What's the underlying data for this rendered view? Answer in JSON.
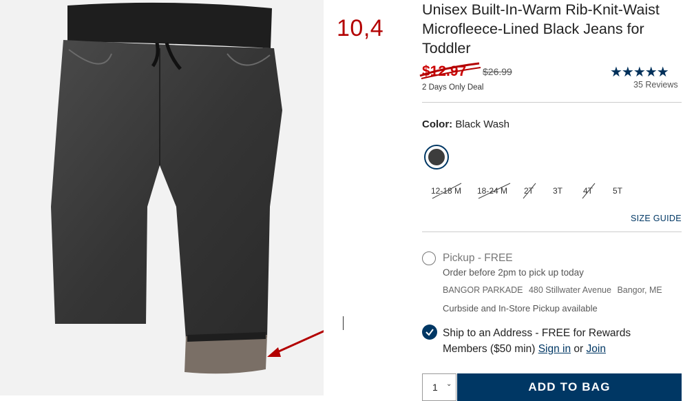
{
  "annotation": {
    "text": "10,4"
  },
  "product": {
    "title": "Unisex Built-In-Warm Rib-Knit-Waist Microfleece-Lined Black Jeans for Toddler",
    "sale_price": "$12.97",
    "original_price": "$26.99",
    "deal_text": "2 Days Only Deal",
    "stars": "★★★★★",
    "rating": 5,
    "reviews": "35 Reviews"
  },
  "color": {
    "label": "Color:",
    "value": "Black Wash",
    "swatch_color": "#3d3d3d"
  },
  "sizes": [
    {
      "label": "12-18 M",
      "available": false
    },
    {
      "label": "18-24 M",
      "available": false
    },
    {
      "label": "2T",
      "available": false
    },
    {
      "label": "3T",
      "available": true
    },
    {
      "label": "4T",
      "available": false
    },
    {
      "label": "5T",
      "available": true
    }
  ],
  "size_guide": "SIZE GUIDE",
  "pickup": {
    "title": "Pickup - FREE",
    "order_note": "Order before 2pm to pick up today",
    "store_name": "BANGOR PARKADE",
    "store_address": "480 Stillwater Avenue",
    "store_city": "Bangor, ME",
    "curbside": "Curbside and In-Store Pickup available"
  },
  "ship": {
    "text_before": "Ship to an Address - FREE for Rewards Members ($50 min)",
    "sign_in": "Sign in",
    "or": "or",
    "join": "Join"
  },
  "quantity": {
    "value": "1",
    "chevron": "⌄"
  },
  "add_to_bag": "ADD TO BAG",
  "colors": {
    "brand_navy": "#003764",
    "sale_red": "#cc0000",
    "annotation_red": "#b30000"
  }
}
